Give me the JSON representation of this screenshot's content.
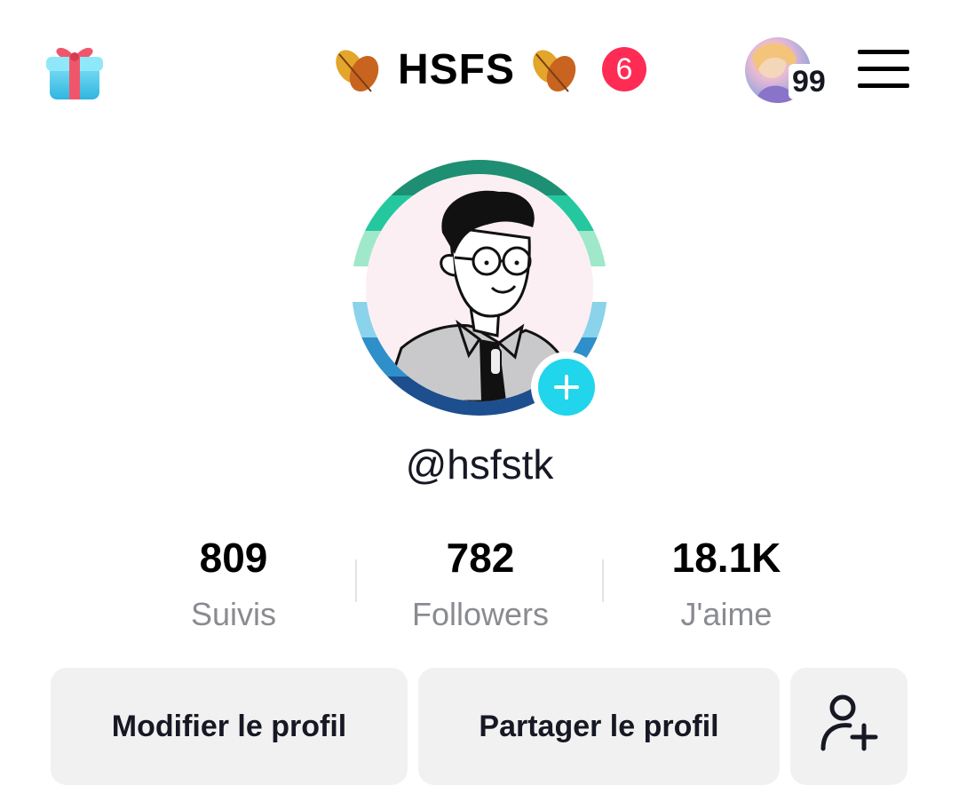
{
  "header": {
    "title": "HSFS",
    "notification_count": "6",
    "avatar_badge_count": "99",
    "icons": [
      "gift-icon",
      "leaf-icon",
      "hamburger-menu-icon"
    ]
  },
  "profile": {
    "username": "@hsfstk"
  },
  "stats": [
    {
      "value": "809",
      "label": "Suivis"
    },
    {
      "value": "782",
      "label": "Followers"
    },
    {
      "value": "18.1K",
      "label": "J'aime"
    }
  ],
  "buttons": {
    "edit": "Modifier le profil",
    "share": "Partager le profil"
  },
  "colors": {
    "notification": "#fe2c55",
    "add_badge": "#20d5ec",
    "button_bg": "#f1f1f2",
    "stat_label": "#8a8b91"
  }
}
